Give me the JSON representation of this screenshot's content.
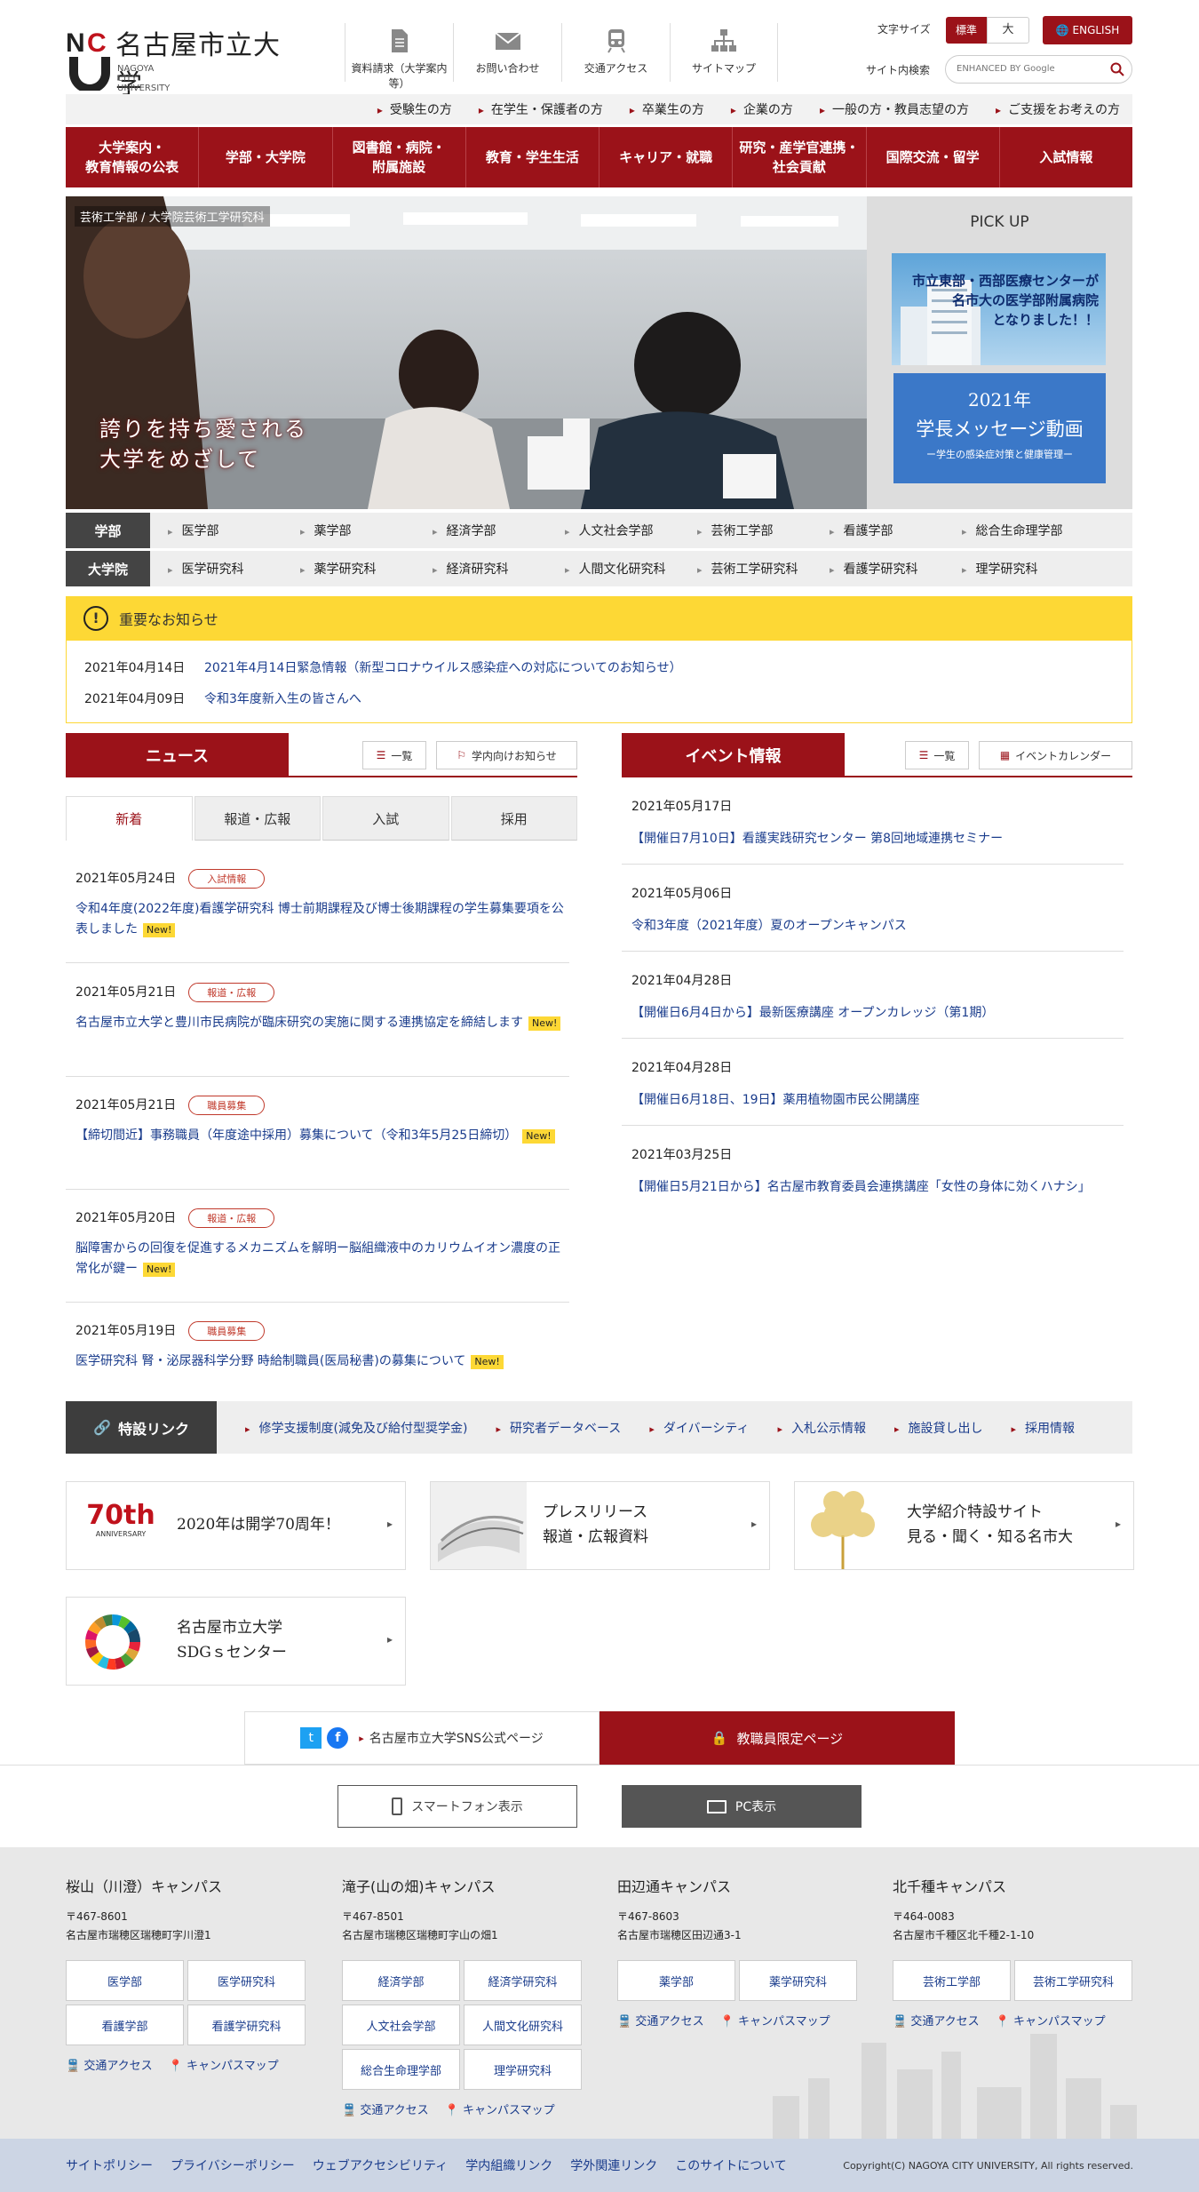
{
  "header": {
    "logo_mark": "NCU",
    "logo_ja": "名古屋市立大学",
    "logo_en": [
      "NAGOYA",
      "CITY",
      "UNIVERSITY"
    ],
    "icons": [
      {
        "label": "資料請求（大学案内等）",
        "icon": "document-icon"
      },
      {
        "label": "お問い合わせ",
        "icon": "mail-icon"
      },
      {
        "label": "交通アクセス",
        "icon": "train-icon"
      },
      {
        "label": "サイトマップ",
        "icon": "sitemap-icon"
      }
    ],
    "fontsize_label": "文字サイズ",
    "fontsize_std": "標準",
    "fontsize_large": "大",
    "english": "ENGLISH",
    "search_label": "サイト内検索",
    "search_placeholder": "ENHANCED BY Google"
  },
  "audience_nav": [
    "受験生の方",
    "在学生・保護者の方",
    "卒業生の方",
    "企業の方",
    "一般の方・教員志望の方",
    "ご支援をお考えの方"
  ],
  "global_nav": [
    "大学案内・\n教育情報の公表",
    "学部・大学院",
    "図書館・病院・\n附属施設",
    "教育・学生生活",
    "キャリア・就職",
    "研究・産学官連携・\n社会貢献",
    "国際交流・留学",
    "入試情報"
  ],
  "hero": {
    "tag": "芸術工学部 / 大学院芸術工学研究科",
    "copy": "誇りを持ち愛される\n大学をめざして"
  },
  "pickup": {
    "title": "PICK UP",
    "item1": "市立東部・西部医療センターが\n名市大の医学部附属病院\nとなりました！！",
    "item2": {
      "line1": "2021年",
      "line2": "学長メッセージ動画",
      "line3": "ー学生の感染症対策と健康管理ー"
    }
  },
  "faculties": {
    "undergrad_label": "学部",
    "undergrad": [
      "医学部",
      "薬学部",
      "経済学部",
      "人文社会学部",
      "芸術工学部",
      "看護学部",
      "総合生命理学部"
    ],
    "grad_label": "大学院",
    "grad": [
      "医学研究科",
      "薬学研究科",
      "経済研究科",
      "人間文化研究科",
      "芸術工学研究科",
      "看護学研究科",
      "理学研究科"
    ]
  },
  "notice": {
    "title": "重要なお知らせ",
    "items": [
      {
        "date": "2021年04月14日",
        "text": "2021年4月14日緊急情報（新型コロナウイルス感染症への対応についてのお知らせ）"
      },
      {
        "date": "2021年04月09日",
        "text": "令和3年度新入生の皆さんへ"
      }
    ]
  },
  "news": {
    "title": "ニュース",
    "list_btn": "一覧",
    "internal_btn": "学内向けお知らせ",
    "tabs": [
      "新着",
      "報道・広報",
      "入試",
      "採用"
    ],
    "items": [
      {
        "date": "2021年05月24日",
        "badge": "入試情報",
        "title": "令和4年度(2022年度)看護学研究科 博士前期課程及び博士後期課程の学生募集要項を公表しました",
        "new": "New!"
      },
      {
        "date": "2021年05月21日",
        "badge": "報道・広報",
        "title": "名古屋市立大学と豊川市民病院が臨床研究の実施に関する連携協定を締結します",
        "new": "New!"
      },
      {
        "date": "2021年05月21日",
        "badge": "職員募集",
        "title": "【締切間近】事務職員（年度途中採用）募集について（令和3年5月25日締切）",
        "new": "New!"
      },
      {
        "date": "2021年05月20日",
        "badge": "報道・広報",
        "title": "脳障害からの回復を促進するメカニズムを解明ー脳組織液中のカリウムイオン濃度の正常化が鍵ー",
        "new": "New!"
      },
      {
        "date": "2021年05月19日",
        "badge": "職員募集",
        "title": "医学研究科 腎・泌尿器科学分野 時給制職員(医局秘書)の募集について",
        "new": "New!"
      }
    ]
  },
  "events": {
    "title": "イベント情報",
    "list_btn": "一覧",
    "calendar_btn": "イベントカレンダー",
    "items": [
      {
        "date": "2021年05月17日",
        "title": "【開催日7月10日】看護実践研究センター 第8回地域連携セミナー"
      },
      {
        "date": "2021年05月06日",
        "title": "令和3年度（2021年度）夏のオープンキャンパス"
      },
      {
        "date": "2021年04月28日",
        "title": "【開催日6月4日から】最新医療講座 オープンカレッジ（第1期）"
      },
      {
        "date": "2021年04月28日",
        "title": "【開催日6月18日、19日】薬用植物園市民公開講座"
      },
      {
        "date": "2021年03月25日",
        "title": "【開催日5月21日から】名古屋市教育委員会連携講座「女性の身体に効くハナシ」"
      }
    ]
  },
  "special_links": {
    "title": "特設リンク",
    "items": [
      "修学支援制度(減免及び給付型奨学金)",
      "研究者データベース",
      "ダイバーシティ",
      "入札公示情報",
      "施設貸し出し",
      "採用情報"
    ]
  },
  "banners": {
    "anniv_logo": "70th",
    "anniv_sub": "ANNIVERSARY",
    "anniv": "2020年は開学70周年！",
    "press": "プレスリリース\n報道・広報資料",
    "intro": "大学紹介特設サイト\n見る・聞く・知る名市大",
    "sdgs": "名古屋市立大学\nSDGｓセンター"
  },
  "sns": {
    "label": "名古屋市立大学SNS公式ページ",
    "staff": "教職員限定ページ"
  },
  "view": {
    "smartphone": "スマートフォン表示",
    "pc": "PC表示"
  },
  "campuses": [
    {
      "name": "桜山（川澄）キャンパス",
      "zip": "〒467-8601",
      "addr": "名古屋市瑞穂区瑞穂町字川澄1",
      "buttons": [
        "医学部",
        "医学研究科",
        "看護学部",
        "看護学研究科"
      ]
    },
    {
      "name": "滝子(山の畑)キャンパス",
      "zip": "〒467-8501",
      "addr": "名古屋市瑞穂区瑞穂町字山の畑1",
      "buttons": [
        "経済学部",
        "経済学研究科",
        "人文社会学部",
        "人間文化研究科",
        "総合生命理学部",
        "理学研究科"
      ]
    },
    {
      "name": "田辺通キャンパス",
      "zip": "〒467-8603",
      "addr": "名古屋市瑞穂区田辺通3-1",
      "buttons": [
        "薬学部",
        "薬学研究科"
      ]
    },
    {
      "name": "北千種キャンパス",
      "zip": "〒464-0083",
      "addr": "名古屋市千種区北千種2-1-10",
      "buttons": [
        "芸術工学部",
        "芸術工学研究科"
      ]
    }
  ],
  "campus_links": {
    "access": "交通アクセス",
    "map": "キャンパスマップ"
  },
  "footer_links": [
    "サイトポリシー",
    "プライバシーポリシー",
    "ウェブアクセシビリティ",
    "学内組織リンク",
    "学外関連リンク",
    "このサイトについて"
  ],
  "copyright": "Copyright(C) NAGOYA CITY UNIVERSITY, All rights reserved.",
  "colors": {
    "brand": "#9b1219",
    "notice": "#fdd835",
    "link": "#1a3c8c"
  }
}
